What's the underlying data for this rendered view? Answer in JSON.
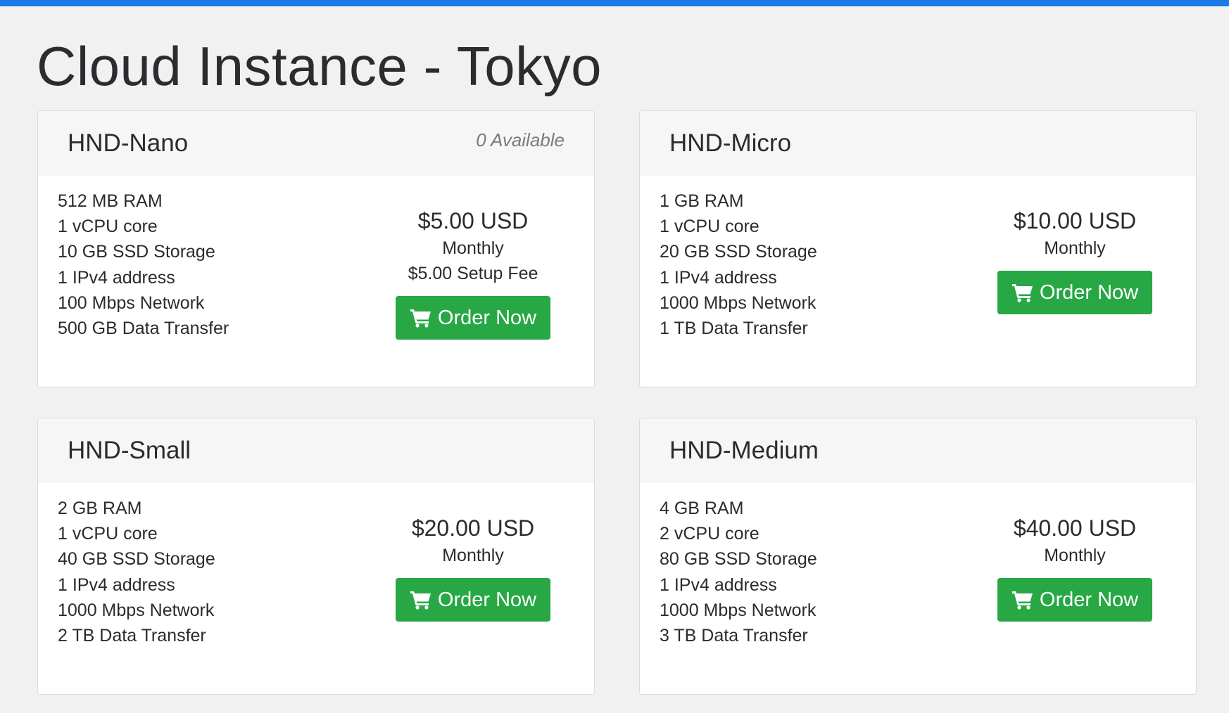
{
  "page": {
    "title": "Cloud Instance - Tokyo",
    "accent_color": "#1a78e8",
    "button_color": "#28a745"
  },
  "plans": [
    {
      "name": "HND-Nano",
      "availability": "0 Available",
      "features": [
        "512 MB RAM",
        "1 vCPU core",
        "10 GB SSD Storage",
        "1 IPv4 address",
        "100 Mbps Network",
        "500 GB Data Transfer"
      ],
      "price": "$5.00 USD",
      "cycle": "Monthly",
      "setup_fee": "$5.00 Setup Fee",
      "order_label": "Order Now",
      "order_icon": "shopping-cart-icon"
    },
    {
      "name": "HND-Micro",
      "availability": "",
      "features": [
        "1 GB RAM",
        "1 vCPU core",
        "20 GB SSD Storage",
        "1 IPv4 address",
        "1000 Mbps Network",
        "1 TB Data Transfer"
      ],
      "price": "$10.00 USD",
      "cycle": "Monthly",
      "setup_fee": "",
      "order_label": "Order Now",
      "order_icon": "shopping-cart-icon"
    },
    {
      "name": "HND-Small",
      "availability": "",
      "features": [
        "2 GB RAM",
        "1 vCPU core",
        "40 GB SSD Storage",
        "1 IPv4 address",
        "1000 Mbps Network",
        "2 TB Data Transfer"
      ],
      "price": "$20.00 USD",
      "cycle": "Monthly",
      "setup_fee": "",
      "order_label": "Order Now",
      "order_icon": "shopping-cart-icon"
    },
    {
      "name": "HND-Medium",
      "availability": "",
      "features": [
        "4 GB RAM",
        "2 vCPU core",
        "80 GB SSD Storage",
        "1 IPv4 address",
        "1000 Mbps Network",
        "3 TB Data Transfer"
      ],
      "price": "$40.00 USD",
      "cycle": "Monthly",
      "setup_fee": "",
      "order_label": "Order Now",
      "order_icon": "shopping-cart-icon"
    }
  ]
}
